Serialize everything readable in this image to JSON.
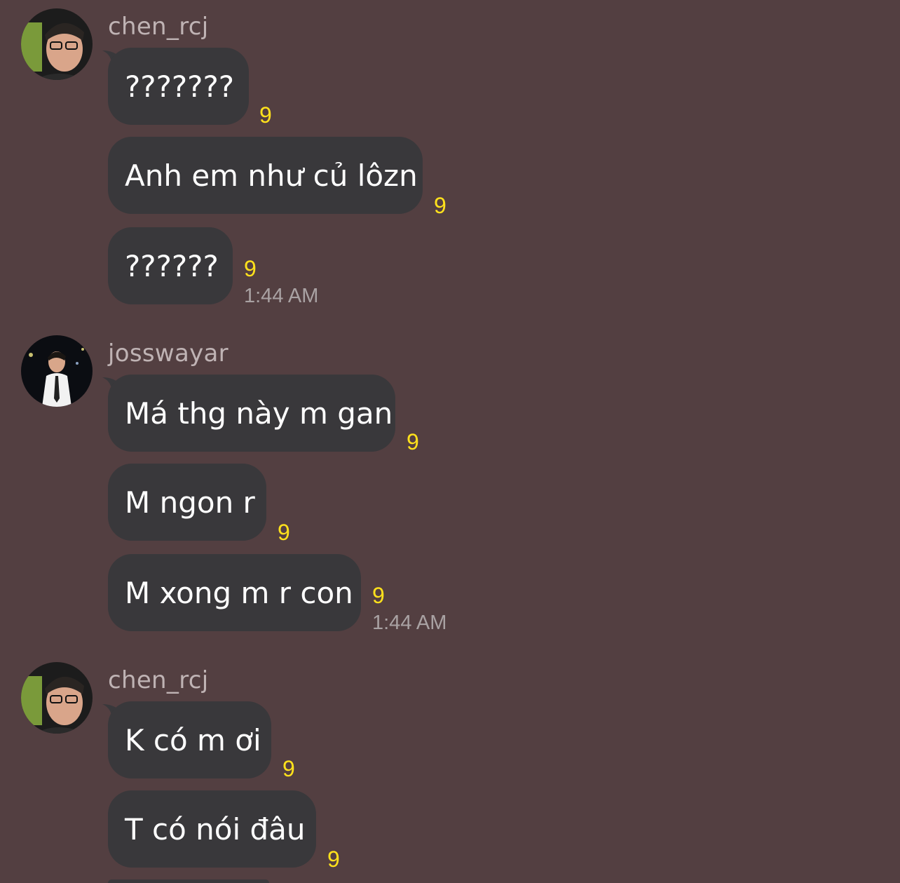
{
  "groups": [
    {
      "username": "chen_rcj",
      "avatar_icon": "avatar-chen-rcj",
      "messages": [
        {
          "text": "???????",
          "reaction": "9"
        },
        {
          "text": "Anh em như củ lôzn",
          "reaction": "9"
        },
        {
          "text": "??????",
          "reaction": "9",
          "time": "1:44 AM"
        }
      ]
    },
    {
      "username": "josswayar",
      "avatar_icon": "avatar-josswayar",
      "messages": [
        {
          "text": "Má thg này m gan",
          "reaction": "9"
        },
        {
          "text": "M ngon r",
          "reaction": "9"
        },
        {
          "text": "M xong m r con",
          "reaction": "9",
          "time": "1:44 AM"
        }
      ]
    },
    {
      "username": "chen_rcj",
      "avatar_icon": "avatar-chen-rcj",
      "messages": [
        {
          "text": "K có m ơi",
          "reaction": "9"
        },
        {
          "text": "T có nói đâu",
          "reaction": "9"
        }
      ]
    }
  ],
  "colors": {
    "background": "#533f41",
    "bubble": "#39383b",
    "reaction": "#ffe11c",
    "username": "#bfb3b4",
    "timestamp": "#a9a2a3"
  }
}
